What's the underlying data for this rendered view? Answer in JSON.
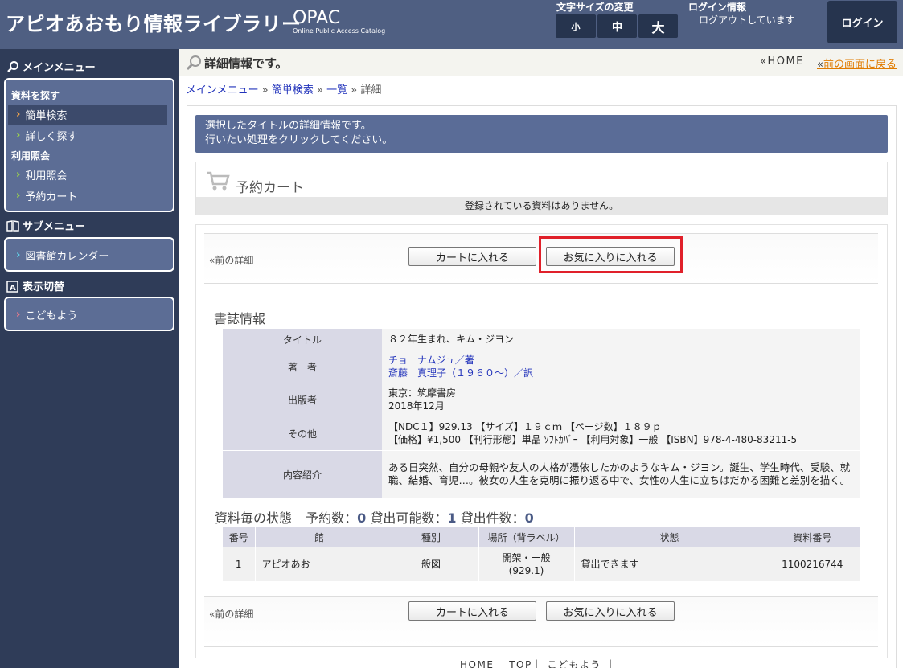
{
  "header": {
    "site_title": "アピオあおもり情報ライブラリー",
    "opac_title": "OPAC",
    "opac_subtitle": "Online Public Access Catalog",
    "font_size_label": "文字サイズの変更",
    "font_sizes": [
      "小",
      "中",
      "大"
    ],
    "login_info_label": "ログイン情報",
    "login_status": "ログアウトしています",
    "login_button": "ログイン"
  },
  "sidebar": {
    "main_menu_title": "メインメニュー",
    "search_group": "資料を探す",
    "simple_search": "簡単検索",
    "detail_search": "詳しく探す",
    "usage_group": "利用照会",
    "usage_inquiry": "利用照会",
    "reserve_cart": "予約カート",
    "sub_menu_title": "サブメニュー",
    "calendar": "図書館カレンダー",
    "display_title": "表示切替",
    "kids": "こどもよう"
  },
  "page": {
    "title": "詳細情報です。",
    "home_link": "«HOME",
    "back_prefix": "«",
    "back_link": "前の画面に戻る",
    "breadcrumb": {
      "main_menu": "メインメニュー",
      "sep": "»",
      "simple_search": "簡単検索",
      "list": "一覧",
      "detail": "詳細"
    },
    "notice_line1": "選択したタイトルの詳細情報です。",
    "notice_line2": "行いたい処理をクリックしてください。"
  },
  "cart": {
    "title": "予約カート",
    "empty_message": "登録されている資料はありません。"
  },
  "actions": {
    "prev_detail": "«前の詳細",
    "add_to_cart": "カートに入れる",
    "add_to_favorites": "お気に入りに入れる"
  },
  "biblio": {
    "section_title": "書誌情報",
    "title_label": "タイトル",
    "title_value": "８２年生まれ、キム・ジヨン",
    "author_label": "著　者",
    "author1": "チョ　ナムジュ／著",
    "author2": "斎藤　真理子（１９６０～）／訳",
    "publisher_label": "出版者",
    "publisher_line1": "東京：筑摩書房",
    "publisher_line2": "2018年12月",
    "other_label": "その他",
    "other_line1": "【NDC１】929.13 【サイズ】１９ｃｍ 【ページ数】１８９ｐ",
    "other_line2": "【価格】¥1,500 【刊行形態】単品 ｿﾌﾄｶﾊﾞｰ 【利用対象】一般 【ISBN】978-4-480-83211-5",
    "summary_label": "内容紹介",
    "summary_value": "ある日突然、自分の母親や友人の人格が憑依したかのようなキム・ジヨン。誕生、学生時代、受験、就職、結婚、育児…。彼女の人生を克明に振り返る中で、女性の人生に立ちはだかる困難と差別を描く。"
  },
  "status": {
    "label": "資料毎の状態",
    "reserve_label": "予約数：",
    "reserve_count": "0",
    "available_label": "貸出可能数：",
    "available_count": "1",
    "loaned_label": "貸出件数：",
    "loaned_count": "0"
  },
  "holdings": {
    "headers": [
      "番号",
      "館",
      "種別",
      "場所（背ラベル）",
      "状態",
      "資料番号"
    ],
    "rows": [
      {
        "no": "1",
        "library": "アピオあお",
        "type": "般図",
        "location1": "開架・一般",
        "location2": "(929.1)",
        "state": "貸出できます",
        "item_no": "1100216744"
      }
    ]
  },
  "footer": {
    "links": "HOME｜ TOP｜ こどもよう ｜"
  }
}
